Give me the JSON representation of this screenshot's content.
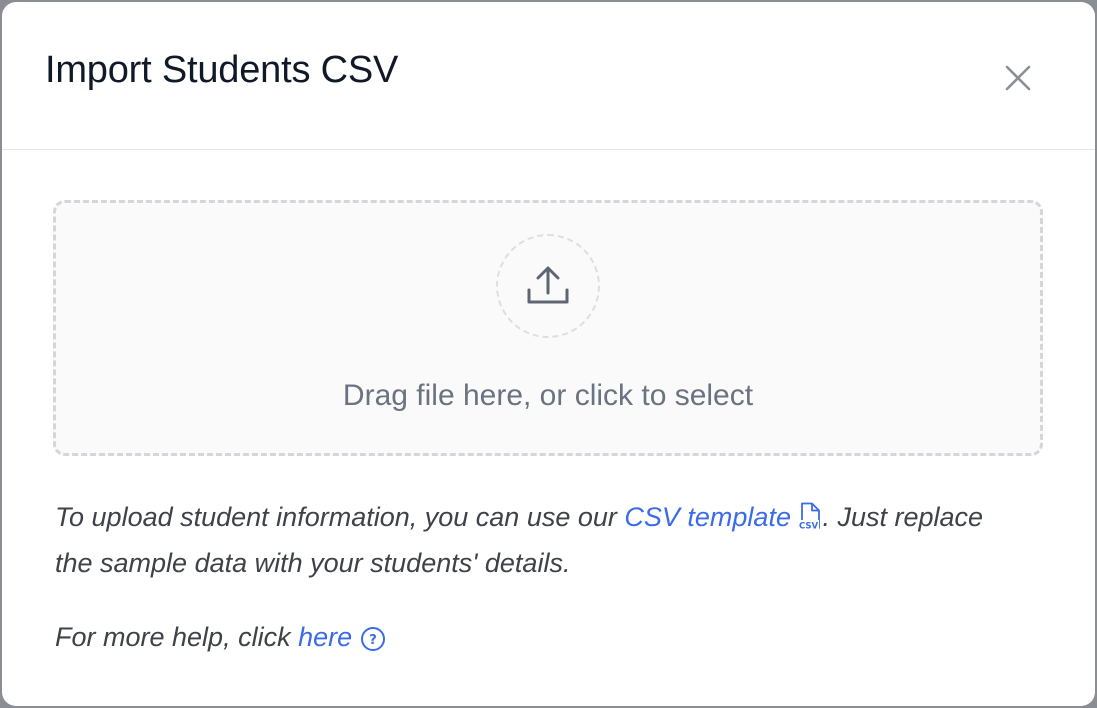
{
  "modal": {
    "title": "Import Students CSV",
    "close_icon": "close-icon"
  },
  "dropzone": {
    "icon": "upload-icon",
    "text": "Drag file here, or click to select"
  },
  "info": {
    "prefix": "To upload student information, you can use our",
    "template_link": "CSV template",
    "file_icon": "csv-file-icon",
    "file_icon_label": "CSV",
    "suffix": ". Just replace the sample data with your students' details."
  },
  "help": {
    "prefix": "For more help, click",
    "link": "here",
    "help_icon": "question-circle-icon",
    "help_icon_label": "?"
  },
  "colors": {
    "link": "#3b6be8",
    "title": "#111827",
    "muted": "#6b7280",
    "body_text": "#3f4247",
    "backdrop": "#8a8d93"
  }
}
